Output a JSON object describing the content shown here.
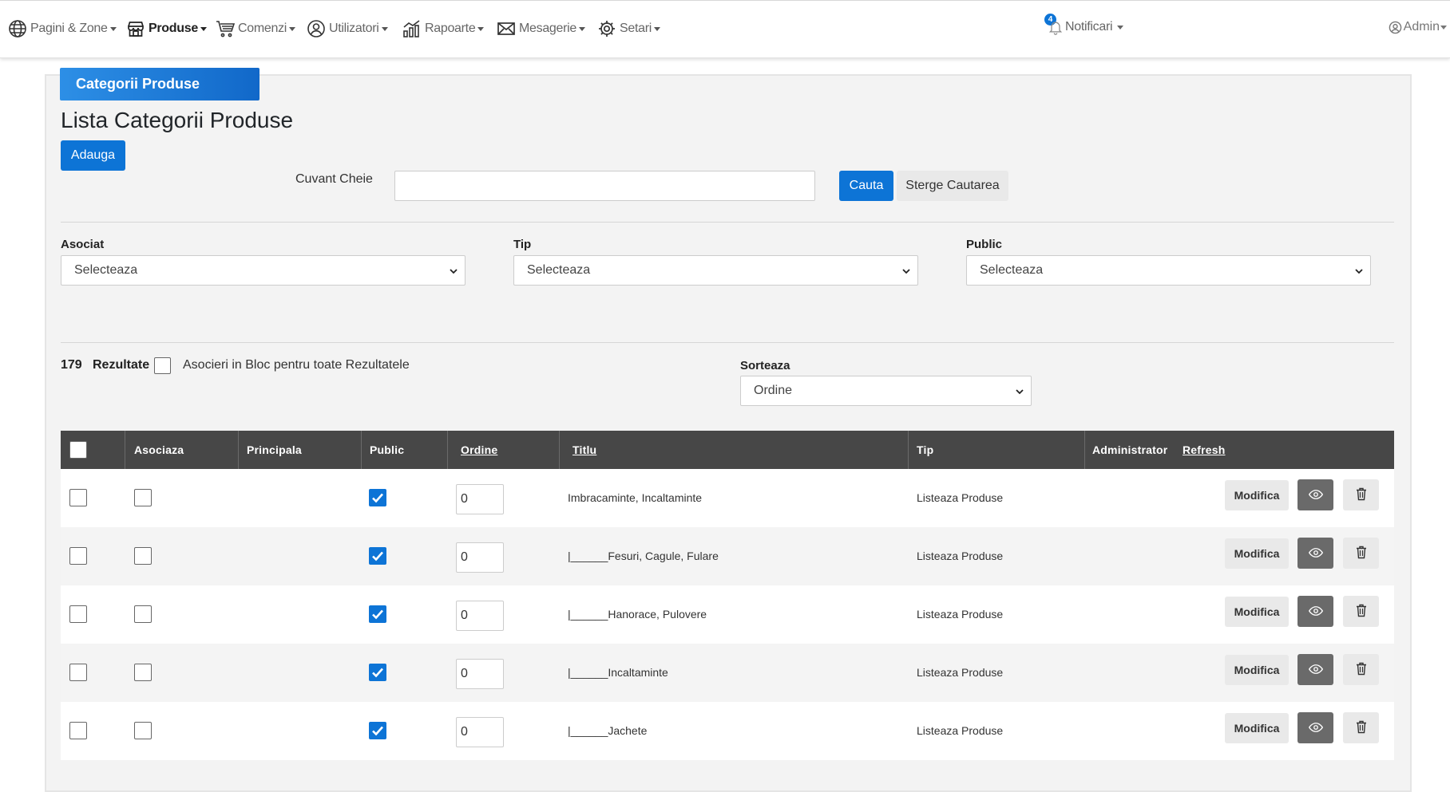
{
  "nav": {
    "items": [
      {
        "label": "Pagini & Zone",
        "icon": "globe-icon"
      },
      {
        "label": "Produse",
        "icon": "store-icon",
        "active": true
      },
      {
        "label": "Comenzi",
        "icon": "cart-icon"
      },
      {
        "label": "Utilizatori",
        "icon": "user-circle-icon"
      },
      {
        "label": "Rapoarte",
        "icon": "chart-icon"
      },
      {
        "label": "Mesagerie",
        "icon": "envelope-icon"
      },
      {
        "label": "Setari",
        "icon": "gear-icon"
      }
    ],
    "notifications": {
      "label": "Notificari",
      "count": "4"
    },
    "user": {
      "label": "Admin"
    }
  },
  "panel": {
    "tab_title": "Categorii Produse",
    "page_title": "Lista Categorii Produse",
    "add_label": "Adauga"
  },
  "search": {
    "keyword_label": "Cuvant Cheie",
    "keyword_value": "",
    "search_label": "Cauta",
    "clear_label": "Sterge Cautarea"
  },
  "filters": {
    "associated": {
      "label": "Asociat",
      "value": "Selecteaza"
    },
    "type": {
      "label": "Tip",
      "value": "Selecteaza"
    },
    "public": {
      "label": "Public",
      "value": "Selecteaza"
    }
  },
  "results": {
    "count": "179",
    "label": "Rezultate",
    "bulk_label": "Asocieri in Bloc pentru toate Rezultatele"
  },
  "sort": {
    "label": "Sorteaza",
    "value": "Ordine"
  },
  "table": {
    "headers": {
      "associate": "Asociaza",
      "main": "Principala",
      "public": "Public",
      "order": "Ordine",
      "title": "Titlu",
      "type": "Tip",
      "admin": "Administrator",
      "refresh": "Refresh"
    },
    "rows": [
      {
        "order": "0",
        "title": "Imbracaminte, Incaltaminte",
        "type": "Listeaza Produse",
        "public": true
      },
      {
        "order": "0",
        "title": "|______Fesuri, Cagule, Fulare",
        "type": "Listeaza Produse",
        "public": true
      },
      {
        "order": "0",
        "title": "|______Hanorace, Pulovere",
        "type": "Listeaza Produse",
        "public": true
      },
      {
        "order": "0",
        "title": "|______Incaltaminte",
        "type": "Listeaza Produse",
        "public": true
      },
      {
        "order": "0",
        "title": "|______Jachete",
        "type": "Listeaza Produse",
        "public": true
      }
    ],
    "edit_label": "Modifica"
  },
  "colors": {
    "primary": "#0d74d6",
    "header_bg": "#474747"
  }
}
